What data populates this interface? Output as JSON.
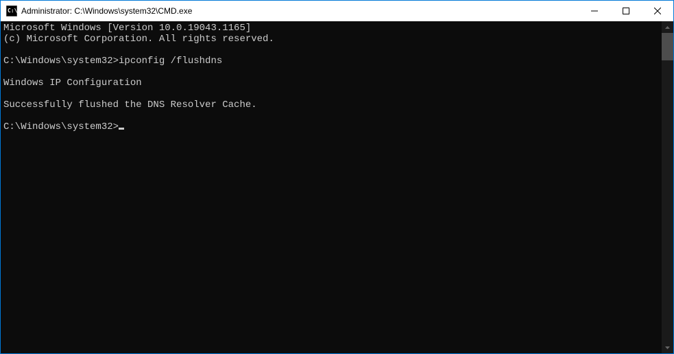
{
  "titlebar": {
    "text": "Administrator: C:\\Windows\\system32\\CMD.exe"
  },
  "terminal": {
    "lines": [
      "Microsoft Windows [Version 10.0.19043.1165]",
      "(c) Microsoft Corporation. All rights reserved.",
      "",
      "C:\\Windows\\system32>ipconfig /flushdns",
      "",
      "Windows IP Configuration",
      "",
      "Successfully flushed the DNS Resolver Cache.",
      "",
      "C:\\Windows\\system32>"
    ]
  }
}
